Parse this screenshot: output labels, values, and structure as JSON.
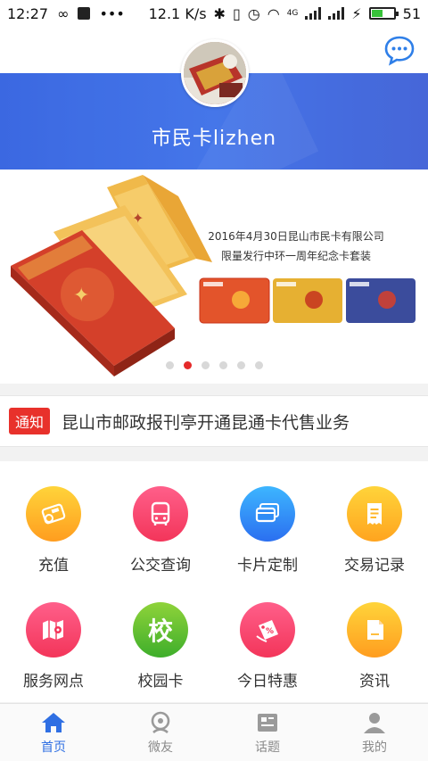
{
  "status_bar": {
    "time": "12:27",
    "speed": "12.1 K/s",
    "network": "4G",
    "battery": "51",
    "battery_level": 0.51
  },
  "header": {
    "username": "市民卡lizhen",
    "avatar_icon": "user-avatar-photo",
    "chat_icon": "chat-bubble-icon"
  },
  "banner": {
    "line1": "2016年4月30日昆山市民卡有限公司",
    "line2": "限量发行中环一周年纪念卡套装",
    "slide_count": 6,
    "active_slide": 2
  },
  "notice": {
    "tag": "通知",
    "text": "昆山市邮政报刊亭开通昆通卡代售业务"
  },
  "services": [
    {
      "label": "充值",
      "icon": "recharge-icon",
      "color_top": "#ffd43a",
      "color_bottom": "#ff9d1f"
    },
    {
      "label": "公交查询",
      "icon": "bus-icon",
      "color_top": "#ff5f8a",
      "color_bottom": "#f3355a"
    },
    {
      "label": "卡片定制",
      "icon": "card-custom-icon",
      "color_top": "#3db6ff",
      "color_bottom": "#2b6ff0"
    },
    {
      "label": "交易记录",
      "icon": "receipt-icon",
      "color_top": "#ffd43a",
      "color_bottom": "#ffa41f"
    },
    {
      "label": "服务网点",
      "icon": "map-icon",
      "color_top": "#ff5f8a",
      "color_bottom": "#f3355a"
    },
    {
      "label": "校园卡",
      "icon": "campus-icon",
      "color_top": "#8fd33a",
      "color_bottom": "#3eae2b",
      "glyph": "校"
    },
    {
      "label": "今日特惠",
      "icon": "discount-icon",
      "color_top": "#ff5f8a",
      "color_bottom": "#f3355a"
    },
    {
      "label": "资讯",
      "icon": "news-icon",
      "color_top": "#ffd43a",
      "color_bottom": "#ff9d1f"
    }
  ],
  "bottom_nav": [
    {
      "label": "首页",
      "icon": "home-icon",
      "active": true
    },
    {
      "label": "微友",
      "icon": "friends-icon",
      "active": false
    },
    {
      "label": "话题",
      "icon": "topic-icon",
      "active": false
    },
    {
      "label": "我的",
      "icon": "profile-icon",
      "active": false
    }
  ],
  "colors": {
    "accent_blue": "#2f6fe3",
    "notice_red": "#e8312b",
    "active_dot": "#e52a2a"
  }
}
